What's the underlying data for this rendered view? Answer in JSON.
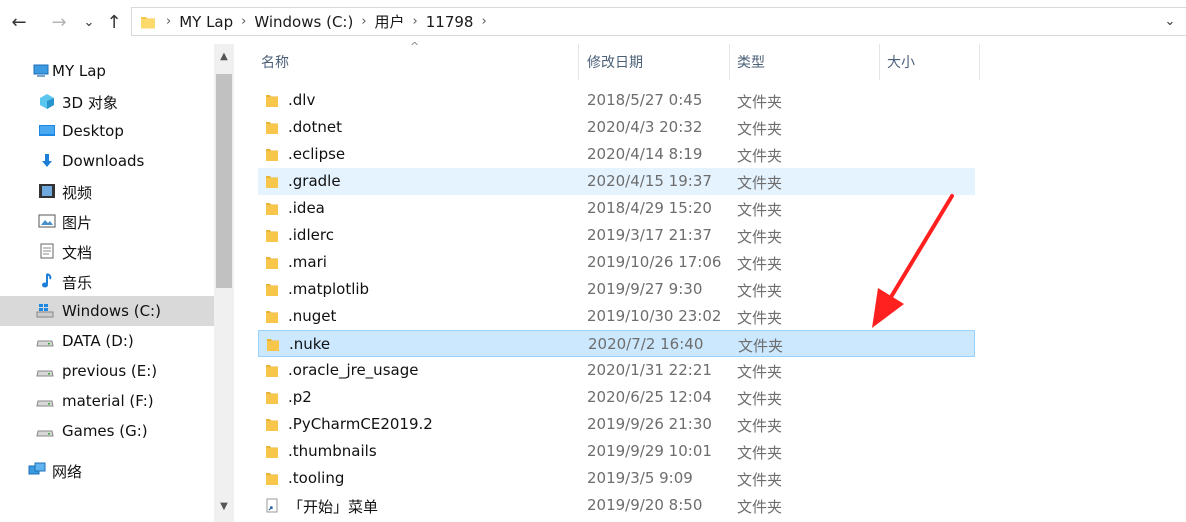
{
  "nav": {
    "back_icon": "arrow-left-icon",
    "forward_icon": "arrow-right-icon",
    "recent_icon": "chevron-down-icon",
    "up_icon": "arrow-up-icon"
  },
  "address": {
    "crumbs": [
      "MY Lap",
      "Windows (C:)",
      "用户",
      "11798"
    ]
  },
  "sidebar": {
    "items": [
      {
        "label": "MY Lap",
        "icon": "computer-icon"
      },
      {
        "label": "3D 对象",
        "icon": "3d-objects-icon"
      },
      {
        "label": "Desktop",
        "icon": "desktop-icon"
      },
      {
        "label": "Downloads",
        "icon": "download-arrow-icon"
      },
      {
        "label": "视频",
        "icon": "video-icon"
      },
      {
        "label": "图片",
        "icon": "picture-icon"
      },
      {
        "label": "文档",
        "icon": "document-icon"
      },
      {
        "label": "音乐",
        "icon": "music-note-icon"
      },
      {
        "label": "Windows (C:)",
        "icon": "windows-drive-icon"
      },
      {
        "label": "DATA (D:)",
        "icon": "drive-icon"
      },
      {
        "label": "previous (E:)",
        "icon": "drive-icon"
      },
      {
        "label": "material (F:)",
        "icon": "drive-icon"
      },
      {
        "label": "Games (G:)",
        "icon": "drive-icon"
      },
      {
        "label": "网络",
        "icon": "network-icon"
      }
    ],
    "selected": "Windows (C:)"
  },
  "columns": {
    "name": "名称",
    "date": "修改日期",
    "type": "类型",
    "size": "大小"
  },
  "files": [
    {
      "name": ".dlv",
      "date": "2018/5/27 0:45",
      "type": "文件夹"
    },
    {
      "name": ".dotnet",
      "date": "2020/4/3 20:32",
      "type": "文件夹"
    },
    {
      "name": ".eclipse",
      "date": "2020/4/14 8:19",
      "type": "文件夹"
    },
    {
      "name": ".gradle",
      "date": "2020/4/15 19:37",
      "type": "文件夹"
    },
    {
      "name": ".idea",
      "date": "2018/4/29 15:20",
      "type": "文件夹"
    },
    {
      "name": ".idlerc",
      "date": "2019/3/17 21:37",
      "type": "文件夹"
    },
    {
      "name": ".mari",
      "date": "2019/10/26 17:06",
      "type": "文件夹"
    },
    {
      "name": ".matplotlib",
      "date": "2019/9/27 9:30",
      "type": "文件夹"
    },
    {
      "name": ".nuget",
      "date": "2019/10/30 23:02",
      "type": "文件夹"
    },
    {
      "name": ".nuke",
      "date": "2020/7/2 16:40",
      "type": "文件夹"
    },
    {
      "name": ".oracle_jre_usage",
      "date": "2020/1/31 22:21",
      "type": "文件夹"
    },
    {
      "name": ".p2",
      "date": "2020/6/25 12:04",
      "type": "文件夹"
    },
    {
      "name": ".PyCharmCE2019.2",
      "date": "2019/9/26 21:30",
      "type": "文件夹"
    },
    {
      "name": ".thumbnails",
      "date": "2019/9/29 10:01",
      "type": "文件夹"
    },
    {
      "name": ".tooling",
      "date": "2019/3/5 9:09",
      "type": "文件夹"
    },
    {
      "name": "「开始」菜单",
      "date": "2019/9/20 8:50",
      "type": "文件夹"
    }
  ],
  "hovered_row": ".gradle",
  "selected_row": ".nuke",
  "colors": {
    "selection": "#cce8ff",
    "hover": "#e5f3ff",
    "annotation_arrow": "#ff2020",
    "folder": "#f7c64a"
  }
}
